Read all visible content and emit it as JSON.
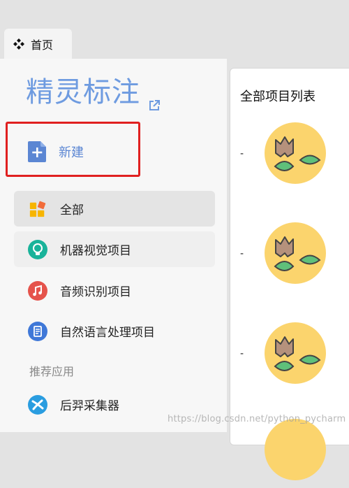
{
  "tab": {
    "label": "首页",
    "icon": "diamond-cluster-icon"
  },
  "sidebar": {
    "app_title": "精灵标注",
    "new_label": "新建",
    "items": [
      {
        "label": "全部",
        "icon": "grid-blocks-icon",
        "active": true
      },
      {
        "label": "机器视觉项目",
        "icon": "lightbulb-icon"
      },
      {
        "label": "音频识别项目",
        "icon": "music-note-icon"
      },
      {
        "label": "自然语言处理项目",
        "icon": "document-icon"
      }
    ],
    "section_label": "推荐应用",
    "apps": [
      {
        "label": "后羿采集器",
        "icon": "houyi-logo-icon"
      }
    ]
  },
  "main": {
    "list_title": "全部项目列表",
    "projects": [
      {
        "name": "-"
      },
      {
        "name": "-"
      },
      {
        "name": "-"
      }
    ]
  },
  "watermark": "https://blog.csdn.net/python_pycharm",
  "colors": {
    "accent": "#6e9be0",
    "highlight_border": "#e02020",
    "avatar_bg": "#fbd46d"
  }
}
